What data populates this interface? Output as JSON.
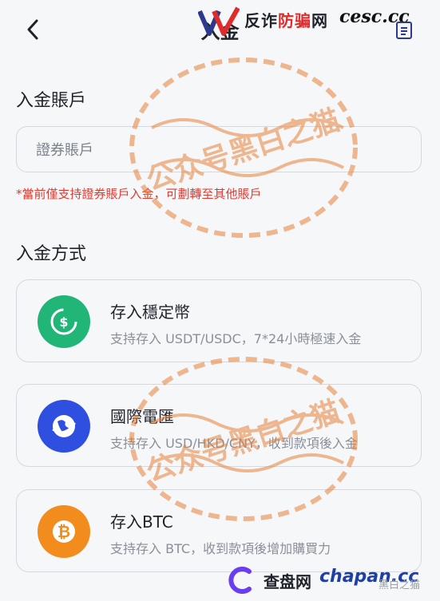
{
  "header": {
    "title": "入金",
    "watermark_text_a": "反诈",
    "watermark_text_b": "防骗",
    "watermark_text_c": "网",
    "watermark_domain": "cesc.cc"
  },
  "account_section": {
    "title": "入金賬戶",
    "input_value": "證券賬戶",
    "note": "*當前僅支持證券賬戶入金，可劃轉至其他賬戶"
  },
  "method_section": {
    "title": "入金方式",
    "methods": [
      {
        "name": "存入穩定幣",
        "desc": "支持存入 USDT/USDC，7*24小時極速入金",
        "icon": "stablecoin-icon",
        "color": "#21b577"
      },
      {
        "name": "國際電匯",
        "desc": "支持存入 USD/HKD/CNY，收到款項後入金",
        "icon": "globe-wire-icon",
        "color": "#2f4fe0"
      },
      {
        "name": "存入BTC",
        "desc": "支持存入 BTC，收到款項後增加購買力",
        "icon": "bitcoin-icon",
        "color": "#f28c1c"
      }
    ]
  },
  "stamp": {
    "text": "公众号黑白之猫",
    "color": "#e9823a"
  },
  "footer": {
    "site": "查盘网",
    "domain": "chapan.cc",
    "brand": "黑白之猫"
  }
}
